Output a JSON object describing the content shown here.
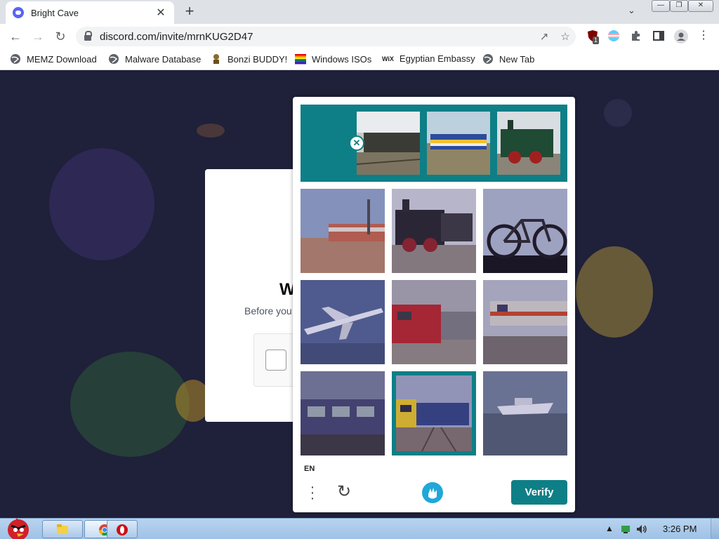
{
  "browser": {
    "tab_title": "Bright Cave",
    "new_tab_symbol": "+",
    "close_symbol": "✕",
    "url": "discord.com/invite/mrnKUG2D47",
    "ext_badge": "1"
  },
  "bookmarks": [
    {
      "label": "MEMZ Download",
      "icon": "globe-icon"
    },
    {
      "label": "Malware Database",
      "icon": "globe-icon"
    },
    {
      "label": "Bonzi BUDDY!",
      "icon": "bonzi-icon"
    },
    {
      "label": "Windows ISOs",
      "icon": "rainbow-flag-icon"
    },
    {
      "label": "Egyptian Embassy",
      "icon": "wix-icon"
    },
    {
      "label": "New Tab",
      "icon": "globe-icon"
    }
  ],
  "wix_text": "WiX",
  "page": {
    "heading_partial": "W",
    "subtext_partial": "Before you"
  },
  "captcha": {
    "examples": [
      "train-photo",
      "train-photo",
      "train-photo"
    ],
    "tiles": [
      {
        "subject": "train-platform",
        "selected": false
      },
      {
        "subject": "steam-locomotive",
        "selected": false
      },
      {
        "subject": "bicycle",
        "selected": false
      },
      {
        "subject": "airplane",
        "selected": false
      },
      {
        "subject": "red-locomotive",
        "selected": false
      },
      {
        "subject": "train-station",
        "selected": false
      },
      {
        "subject": "train-interior",
        "selected": false
      },
      {
        "subject": "yellow-train",
        "selected": true
      },
      {
        "subject": "boat",
        "selected": false
      }
    ],
    "language": "EN",
    "verify_label": "Verify",
    "accent_color": "#0e7f86"
  },
  "taskbar": {
    "clock": "3:26 PM"
  }
}
